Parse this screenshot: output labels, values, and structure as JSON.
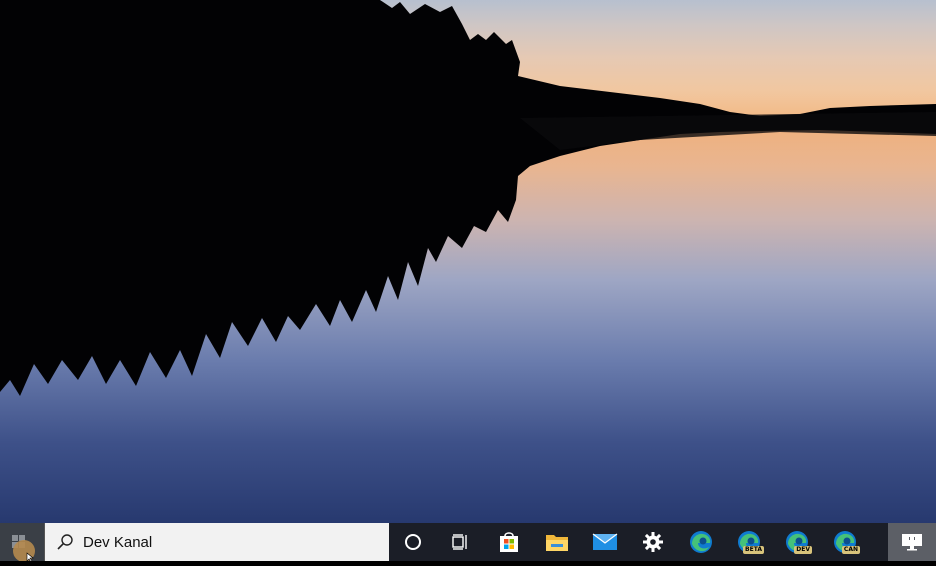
{
  "taskbar": {
    "search_placeholder": "Dev Kanal",
    "icons": [
      {
        "name": "cortana-icon"
      },
      {
        "name": "task-view-icon"
      },
      {
        "name": "microsoft-store-icon"
      },
      {
        "name": "file-explorer-icon"
      },
      {
        "name": "mail-icon"
      },
      {
        "name": "settings-icon"
      },
      {
        "name": "edge-icon"
      },
      {
        "name": "edge-beta-icon",
        "badge": "BETA"
      },
      {
        "name": "edge-dev-icon",
        "badge": "DEV"
      },
      {
        "name": "edge-canary-icon",
        "badge": "CAN"
      }
    ],
    "tray_icon": "desktop-display-icon"
  },
  "colors": {
    "taskbar_bg": "#1b1e27",
    "search_bg": "#f2f2f2",
    "edge_blue": "#0f7bd0",
    "edge_green": "#45c17a"
  }
}
